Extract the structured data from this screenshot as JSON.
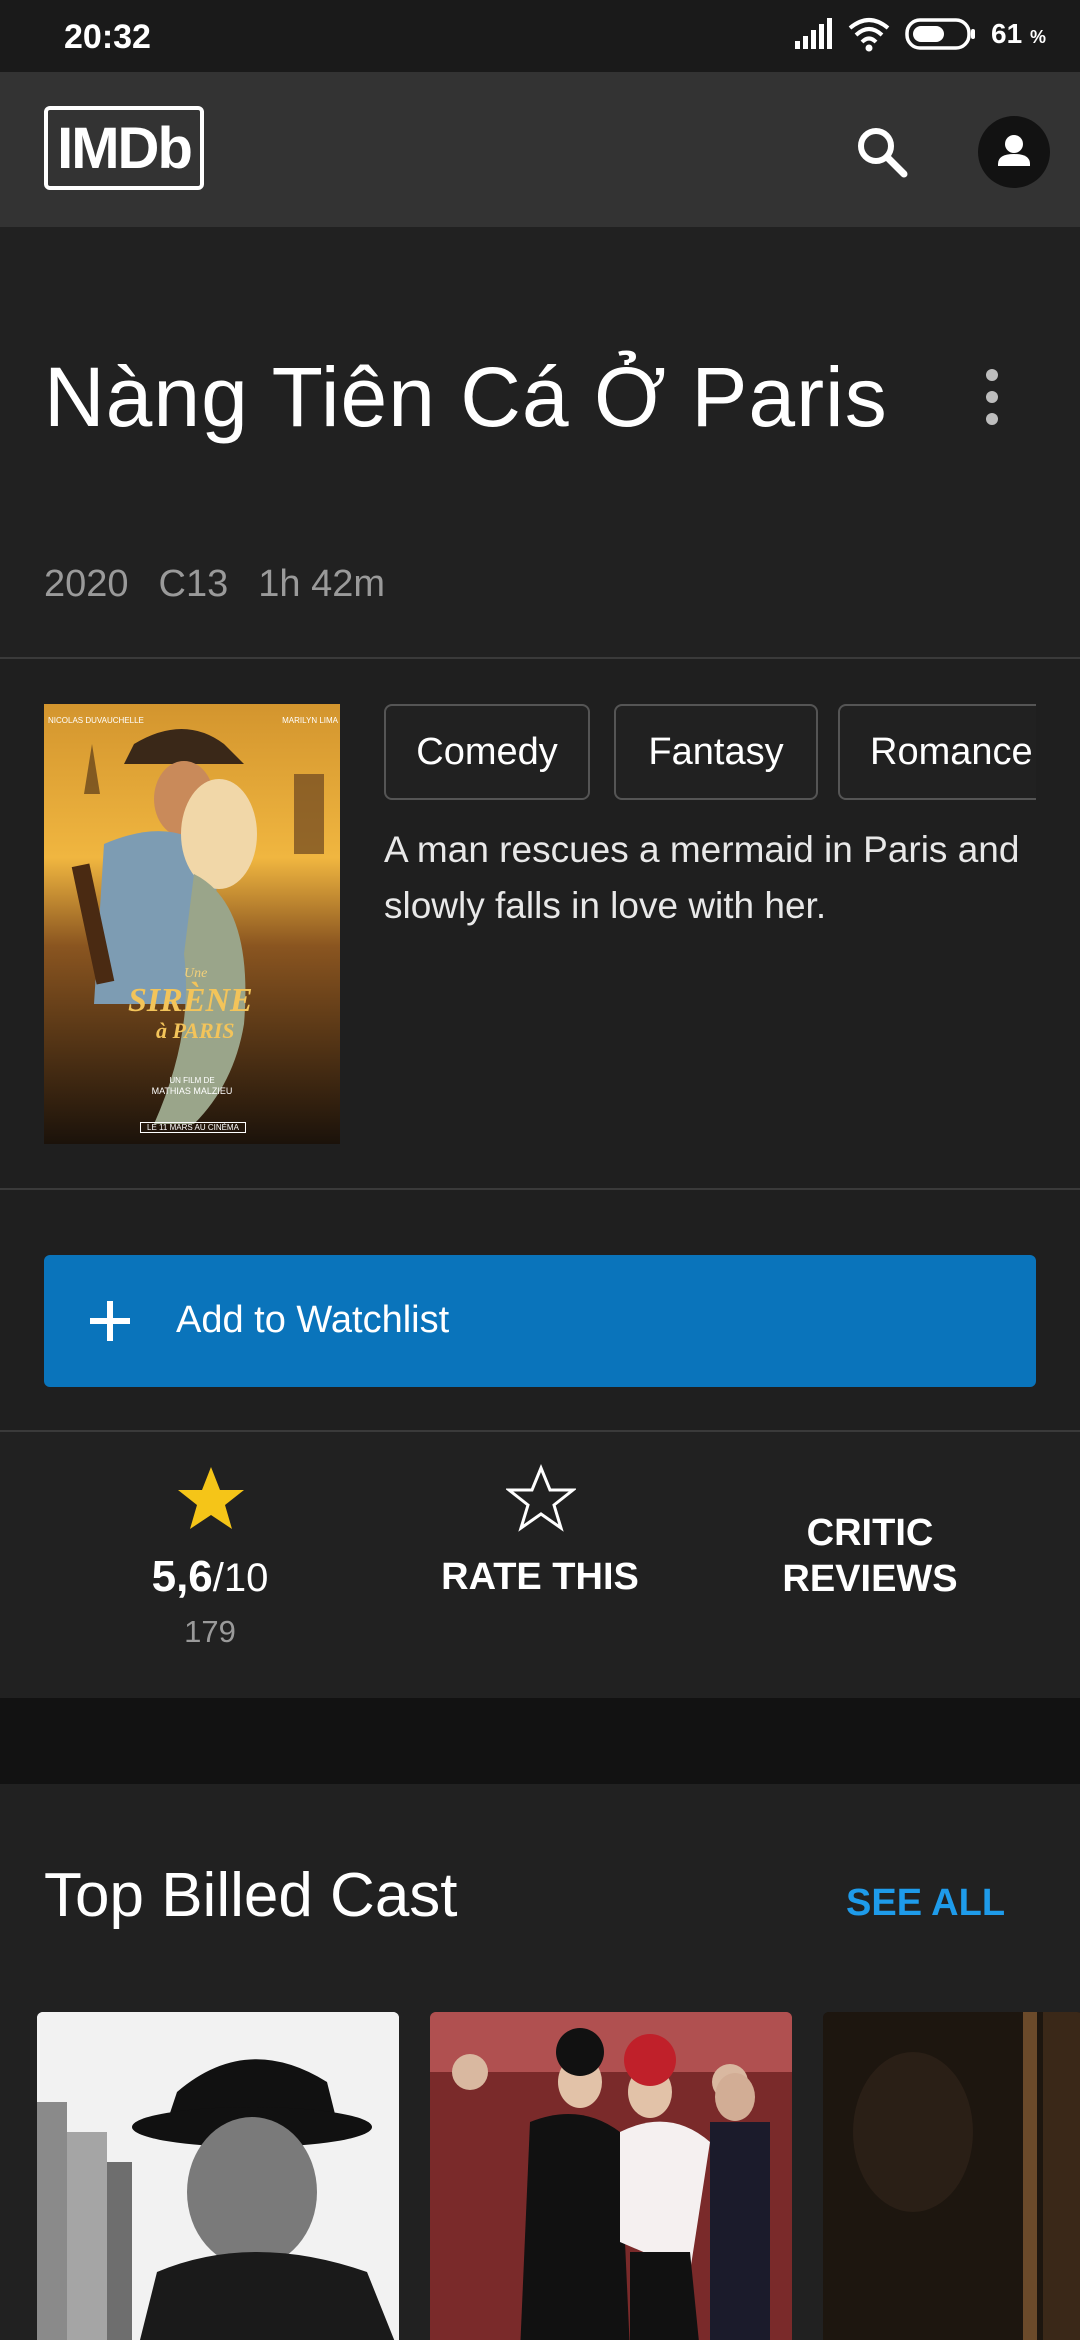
{
  "status_bar": {
    "time": "20:32",
    "battery_percent": "61",
    "battery_unit": "%",
    "battery_level": 0.61,
    "icons": [
      "signal-icon",
      "wifi-icon",
      "battery-icon"
    ]
  },
  "app_bar": {
    "logo_text": "IMDb",
    "icons": [
      "search-icon",
      "account-icon"
    ]
  },
  "movie": {
    "title": "Nàng Tiên Cá Ở Paris",
    "year": "2020",
    "certificate": "C13",
    "runtime": "1h 42m",
    "genres": [
      "Comedy",
      "Fantasy",
      "Romance"
    ],
    "plot": "A man rescues a mermaid in Paris and slowly falls in love with her.",
    "poster": {
      "top_left_credit": "NICOLAS DUVAUCHELLE",
      "top_right_credit": "MARILYN LIMA",
      "title_line1": "Une",
      "title_line2": "SIRÈNE",
      "title_line3": "à PARIS",
      "director_line1": "UN FILM DE",
      "director_line2": "MATHIAS MALZIEU",
      "release_line": "LE 11 MARS AU CINÉMA"
    }
  },
  "watchlist": {
    "label": "Add to Watchlist",
    "icon": "plus-icon"
  },
  "ratings": {
    "score": "5,6",
    "out_of": "/10",
    "votes": "179",
    "rate_label": "RATE THIS",
    "critic_label_line1": "CRITIC",
    "critic_label_line2": "REVIEWS"
  },
  "cast": {
    "section_title": "Top Billed Cast",
    "see_all_label": "SEE ALL"
  },
  "colors": {
    "accent_blue": "#0a74bb",
    "link_blue": "#1e9bea",
    "star_gold": "#f5c518",
    "background": "#1f1f1f",
    "app_bar": "#333333"
  }
}
